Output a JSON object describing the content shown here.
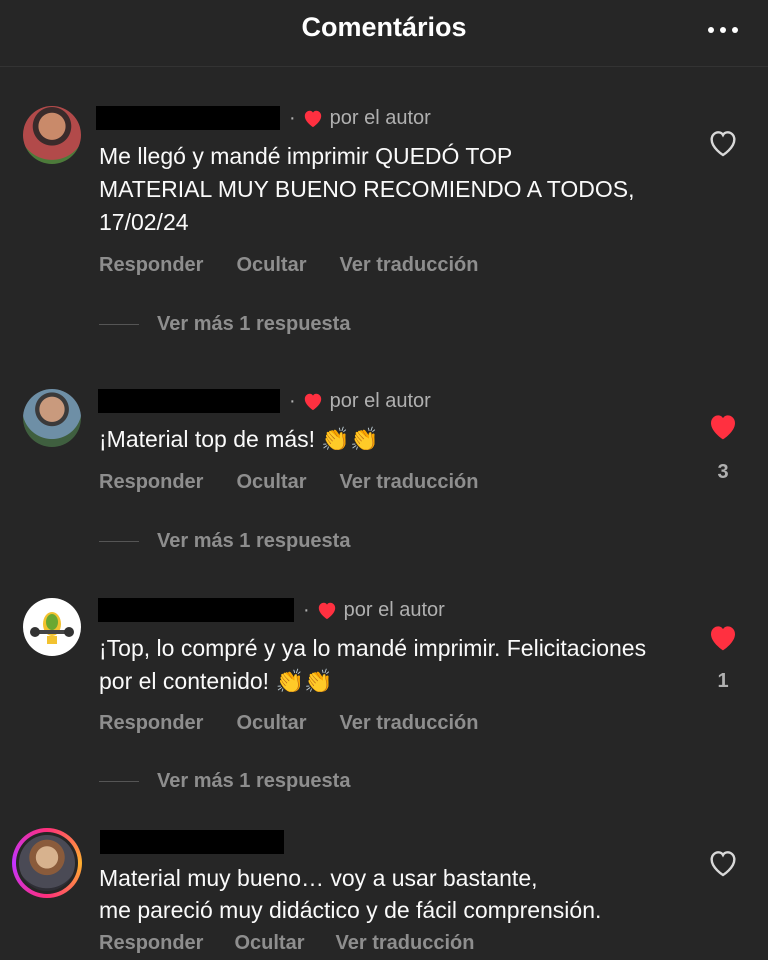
{
  "header": {
    "title": "Comentários",
    "more_icon": "more-horizontal-icon"
  },
  "colors": {
    "background": "#262626",
    "like_red": "#ff3040",
    "muted": "#8e8e8e"
  },
  "actions": {
    "reply": "Responder",
    "hide": "Ocultar",
    "translate": "Ver traducción"
  },
  "comments": [
    {
      "badge": "por el autor",
      "text": "Me llegó y mandé imprimir QUEDÓ TOP\nMATERIAL MUY BUENO RECOMIENDO A TODOS,\n17/02/24",
      "liked": false,
      "like_count": "",
      "view_replies": "Ver más 1 respuesta"
    },
    {
      "badge": "por el autor",
      "text": "¡Material top de más! 👏👏",
      "liked": true,
      "like_count": "3",
      "view_replies": "Ver más 1 respuesta"
    },
    {
      "badge": "por el autor",
      "text": "¡Top, lo compré y ya lo mandé imprimir. Felicitaciones\npor el contenido! 👏👏",
      "liked": true,
      "like_count": "1",
      "view_replies": "Ver más 1 respuesta"
    },
    {
      "badge": "",
      "text": "Material muy bueno… voy a usar bastante,\nme pareció muy didáctico y de fácil comprensión.",
      "liked": false,
      "like_count": ""
    }
  ]
}
